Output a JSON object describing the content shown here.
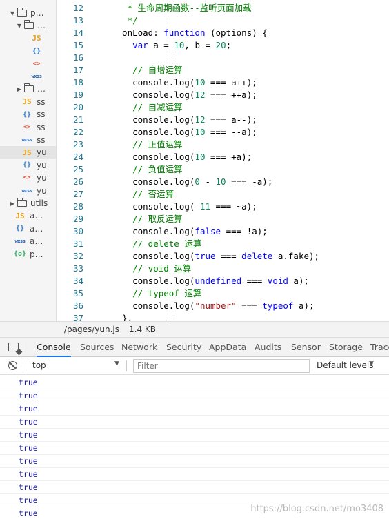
{
  "tree": [
    {
      "kind": "folder",
      "indent": 1,
      "arrow": "down",
      "name": "p…",
      "selected": false
    },
    {
      "kind": "folder",
      "indent": 2,
      "arrow": "down",
      "name": "…",
      "selected": false
    },
    {
      "kind": "file",
      "indent": 3,
      "icon": "JS",
      "type": "js",
      "name": "",
      "selected": false
    },
    {
      "kind": "file",
      "indent": 3,
      "icon": "{}",
      "type": "json",
      "name": "",
      "selected": false
    },
    {
      "kind": "file",
      "indent": 3,
      "icon": "<>",
      "type": "wxml",
      "name": "",
      "selected": false
    },
    {
      "kind": "file",
      "indent": 3,
      "icon": "wxss",
      "type": "wxss",
      "name": "",
      "selected": false
    },
    {
      "kind": "folder",
      "indent": 2,
      "arrow": "right",
      "name": "…",
      "selected": false
    },
    {
      "kind": "file",
      "indent": 2,
      "icon": "JS",
      "type": "js",
      "name": "ss",
      "selected": false
    },
    {
      "kind": "file",
      "indent": 2,
      "icon": "{}",
      "type": "json",
      "name": "ss",
      "selected": false
    },
    {
      "kind": "file",
      "indent": 2,
      "icon": "<>",
      "type": "wxml",
      "name": "ss",
      "selected": false
    },
    {
      "kind": "file",
      "indent": 2,
      "icon": "wxss",
      "type": "wxss",
      "name": "ss",
      "selected": false
    },
    {
      "kind": "file",
      "indent": 2,
      "icon": "JS",
      "type": "js",
      "name": "yu",
      "selected": true
    },
    {
      "kind": "file",
      "indent": 2,
      "icon": "{}",
      "type": "json",
      "name": "yu",
      "selected": false
    },
    {
      "kind": "file",
      "indent": 2,
      "icon": "<>",
      "type": "wxml",
      "name": "yu",
      "selected": false
    },
    {
      "kind": "file",
      "indent": 2,
      "icon": "wxss",
      "type": "wxss",
      "name": "yu",
      "selected": false
    },
    {
      "kind": "folder",
      "indent": 1,
      "arrow": "right",
      "name": "utils",
      "selected": false
    },
    {
      "kind": "file",
      "indent": 1,
      "icon": "JS",
      "type": "js",
      "name": "a…",
      "selected": false
    },
    {
      "kind": "file",
      "indent": 1,
      "icon": "{}",
      "type": "json",
      "name": "a…",
      "selected": false
    },
    {
      "kind": "file",
      "indent": 1,
      "icon": "wxss",
      "type": "wxss",
      "name": "a…",
      "selected": false
    },
    {
      "kind": "file",
      "indent": 1,
      "icon": "{o}",
      "type": "sitemap",
      "name": "p…",
      "selected": false
    }
  ],
  "code": [
    {
      "n": "12",
      "t": [
        [
          "c",
          "   * 生命周期函数--监听页面加载"
        ]
      ]
    },
    {
      "n": "13",
      "t": [
        [
          "c",
          "   */"
        ]
      ]
    },
    {
      "n": "14",
      "t": [
        [
          "p",
          "  onLoad: "
        ],
        [
          "k",
          "function"
        ],
        [
          "p",
          " (options) {"
        ]
      ]
    },
    {
      "n": "15",
      "t": [
        [
          "p",
          "    "
        ],
        [
          "k",
          "var"
        ],
        [
          "p",
          " a = "
        ],
        [
          "d",
          "10"
        ],
        [
          "p",
          ", b = "
        ],
        [
          "d",
          "20"
        ],
        [
          "p",
          ";"
        ]
      ]
    },
    {
      "n": "16",
      "t": []
    },
    {
      "n": "17",
      "t": [
        [
          "c",
          "    // 自增运算"
        ]
      ]
    },
    {
      "n": "18",
      "t": [
        [
          "p",
          "    console.log("
        ],
        [
          "d",
          "10"
        ],
        [
          "p",
          " === a++);"
        ]
      ]
    },
    {
      "n": "19",
      "t": [
        [
          "p",
          "    console.log("
        ],
        [
          "d",
          "12"
        ],
        [
          "p",
          " === ++a);"
        ]
      ]
    },
    {
      "n": "20",
      "t": [
        [
          "c",
          "    // 自减运算"
        ]
      ]
    },
    {
      "n": "21",
      "t": [
        [
          "p",
          "    console.log("
        ],
        [
          "d",
          "12"
        ],
        [
          "p",
          " === a--);"
        ]
      ]
    },
    {
      "n": "22",
      "t": [
        [
          "p",
          "    console.log("
        ],
        [
          "d",
          "10"
        ],
        [
          "p",
          " === --a);"
        ]
      ]
    },
    {
      "n": "23",
      "t": [
        [
          "c",
          "    // 正值运算"
        ]
      ]
    },
    {
      "n": "24",
      "t": [
        [
          "p",
          "    console.log("
        ],
        [
          "d",
          "10"
        ],
        [
          "p",
          " === +a);"
        ]
      ]
    },
    {
      "n": "25",
      "t": [
        [
          "c",
          "    // 负值运算"
        ]
      ]
    },
    {
      "n": "26",
      "t": [
        [
          "p",
          "    console.log("
        ],
        [
          "d",
          "0"
        ],
        [
          "p",
          " - "
        ],
        [
          "d",
          "10"
        ],
        [
          "p",
          " === -a);"
        ]
      ]
    },
    {
      "n": "27",
      "t": [
        [
          "c",
          "    // 否运算"
        ]
      ]
    },
    {
      "n": "28",
      "t": [
        [
          "p",
          "    console.log(-"
        ],
        [
          "d",
          "11"
        ],
        [
          "p",
          " === ~a);"
        ]
      ]
    },
    {
      "n": "29",
      "t": [
        [
          "c",
          "    // 取反运算"
        ]
      ]
    },
    {
      "n": "30",
      "t": [
        [
          "p",
          "    console.log("
        ],
        [
          "k",
          "false"
        ],
        [
          "p",
          " === !a);"
        ]
      ]
    },
    {
      "n": "31",
      "t": [
        [
          "c",
          "    // delete 运算"
        ]
      ]
    },
    {
      "n": "32",
      "t": [
        [
          "p",
          "    console.log("
        ],
        [
          "k",
          "true"
        ],
        [
          "p",
          " === "
        ],
        [
          "k",
          "delete"
        ],
        [
          "p",
          " a.fake);"
        ]
      ]
    },
    {
      "n": "33",
      "t": [
        [
          "c",
          "    // void 运算"
        ]
      ]
    },
    {
      "n": "34",
      "t": [
        [
          "p",
          "    console.log("
        ],
        [
          "k",
          "undefined"
        ],
        [
          "p",
          " === "
        ],
        [
          "k",
          "void"
        ],
        [
          "p",
          " a);"
        ]
      ]
    },
    {
      "n": "35",
      "t": [
        [
          "c",
          "    // typeof 运算"
        ]
      ]
    },
    {
      "n": "36",
      "t": [
        [
          "p",
          "    console.log("
        ],
        [
          "s",
          "\"number\""
        ],
        [
          "p",
          " === "
        ],
        [
          "k",
          "typeof"
        ],
        [
          "p",
          " a);"
        ]
      ]
    },
    {
      "n": "37",
      "t": [
        [
          "p",
          "  },"
        ]
      ]
    }
  ],
  "status": {
    "path": "/pages/yun.js",
    "size": "1.4 KB"
  },
  "devtools": {
    "tabs": [
      "Console",
      "Sources",
      "Network",
      "Security",
      "AppData",
      "Audits",
      "Sensor",
      "Storage",
      "Trace"
    ],
    "active_tab": "Console"
  },
  "console": {
    "context": "top",
    "filter_placeholder": "Filter",
    "levels": "Default levels",
    "output": [
      "true",
      "true",
      "true",
      "true",
      "true",
      "true",
      "true",
      "true",
      "true",
      "true",
      "true"
    ]
  },
  "watermark": "https://blog.csdn.net/mo3408",
  "colors": {
    "keyword": "#0000ff",
    "comment": "#008000",
    "number": "#098658",
    "string": "#a31515",
    "line_number": "#237893",
    "console_value": "#1a1aa6",
    "active_tab": "#1a73e8"
  },
  "icons": [
    "folder-icon",
    "js-file-icon",
    "json-file-icon",
    "wxml-file-icon",
    "wxss-file-icon",
    "sitemap-file-icon",
    "inspect-element-icon",
    "clear-console-icon"
  ]
}
